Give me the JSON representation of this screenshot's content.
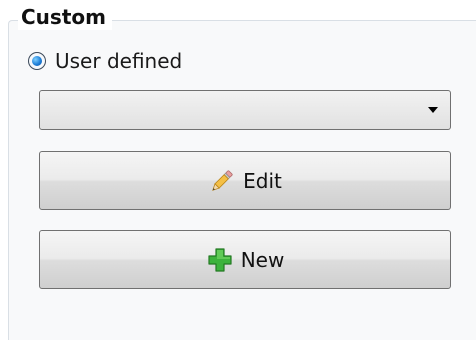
{
  "group": {
    "title": "Custom"
  },
  "radio": {
    "label": "User defined",
    "checked": true
  },
  "dropdown": {
    "selected_value": ""
  },
  "buttons": {
    "edit_label": "Edit",
    "new_label": "New"
  },
  "icons": {
    "radio": "radio-selected-icon",
    "dropdown": "chevron-down-icon",
    "edit": "pencil-icon",
    "new": "plus-icon"
  },
  "colors": {
    "radio_selected": "#1e7fd8",
    "new_icon": "#33a532",
    "edit_icon": "#f2b134"
  }
}
